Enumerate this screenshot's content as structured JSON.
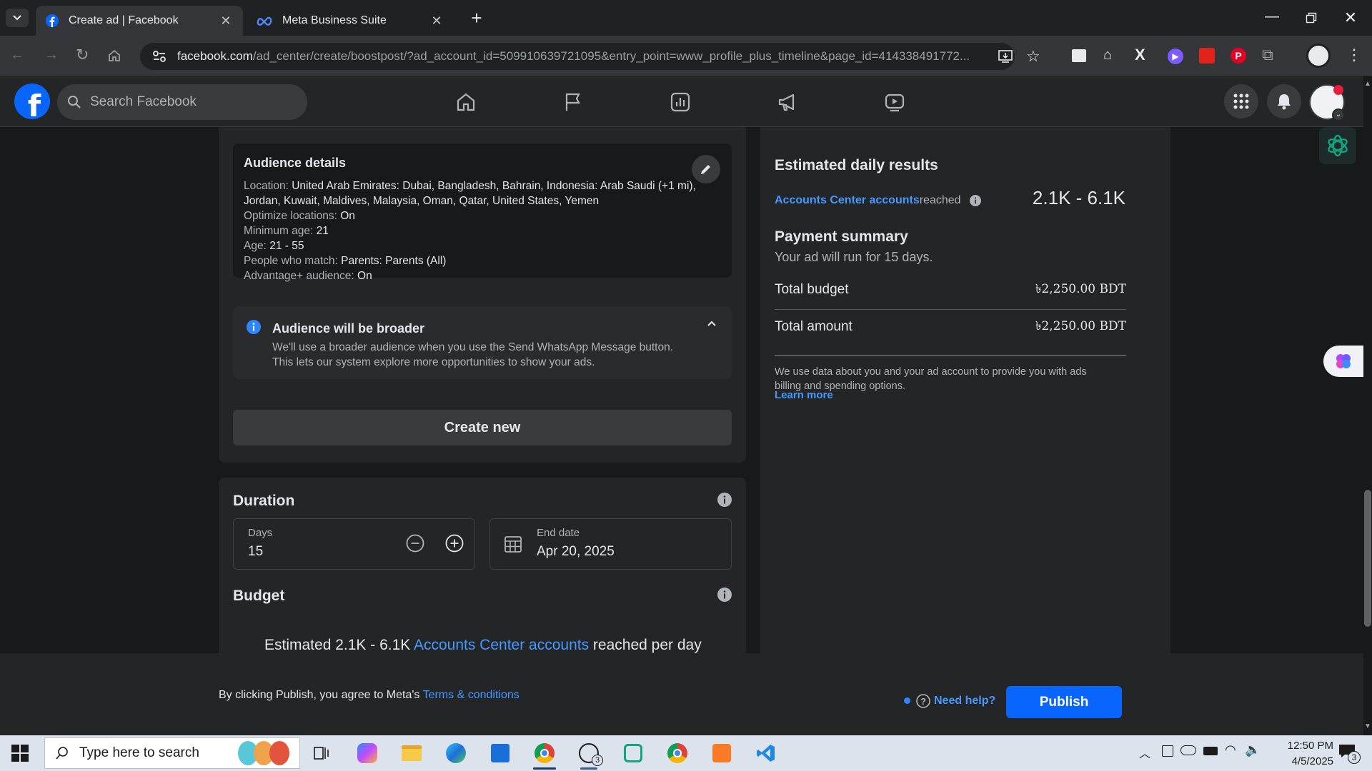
{
  "browser": {
    "tabs": [
      {
        "title": "Create ad | Facebook",
        "active": true
      },
      {
        "title": "Meta Business Suite",
        "active": false
      }
    ],
    "url_domain": "facebook.com",
    "url_path": "/ad_center/create/boostpost/?ad_account_id=509910639721095&entry_point=www_profile_plus_timeline&page_id=414338491772..."
  },
  "facebook": {
    "search_placeholder": "Search Facebook"
  },
  "audience": {
    "title": "Audience details",
    "location_label": "Location: ",
    "location_value": "United Arab Emirates: Dubai, Bangladesh, Bahrain, Indonesia: Arab Saudi (+1 mi),",
    "location_value2": "Jordan, Kuwait, Maldives, Malaysia, Oman, Qatar, United States, Yemen",
    "optimize_label": "Optimize locations: ",
    "optimize_value": "On",
    "minage_label": "Minimum age: ",
    "minage_value": "21",
    "age_label": "Age: ",
    "age_value": "21 - 55",
    "match_label": "People who match: ",
    "match_value": "Parents: Parents (All)",
    "advantage_label": "Advantage+ audience: ",
    "advantage_value": "On"
  },
  "notice": {
    "title": "Audience will be broader",
    "line1": "We'll use a broader audience when you use the Send WhatsApp Message button.",
    "line2": "This lets our system explore more opportunities to show your ads."
  },
  "create_new_label": "Create new",
  "duration": {
    "title": "Duration",
    "days_label": "Days",
    "days_value": "15",
    "end_label": "End date",
    "end_value": "Apr 20, 2025"
  },
  "budget": {
    "title": "Budget",
    "est_prefix": "Estimated 2.1K - 6.1K ",
    "est_link": "Accounts Center accounts",
    "est_suffix": " reached per day"
  },
  "results": {
    "title": "Estimated daily results",
    "reach_link": "Accounts Center accounts",
    "reach_suffix": " reached",
    "reach_value": "2.1K - 6.1K"
  },
  "payment": {
    "title": "Payment summary",
    "subtitle": "Your ad will run for 15 days.",
    "total_budget_label": "Total budget",
    "total_budget_value": "৳2,250.00 BDT",
    "total_amount_label": "Total amount",
    "total_amount_value": "৳2,250.00 BDT",
    "disclaimer1": "We use data about you and your ad account to provide you with ads",
    "disclaimer2": "billing and spending options.",
    "learn_more": "Learn more"
  },
  "footer": {
    "agree_prefix": "By clicking Publish, you agree to Meta's ",
    "terms": "Terms & conditions",
    "need_help": "Need help?",
    "publish": "Publish"
  },
  "taskbar": {
    "search_placeholder": "Type here to search",
    "time": "12:50 PM",
    "date": "4/5/2025",
    "whatsapp_badge": "3",
    "notif_badge": "3"
  },
  "colors": {
    "accent": "#0866ff",
    "link": "#4599ff",
    "bg": "#18191a",
    "card": "#242526"
  }
}
